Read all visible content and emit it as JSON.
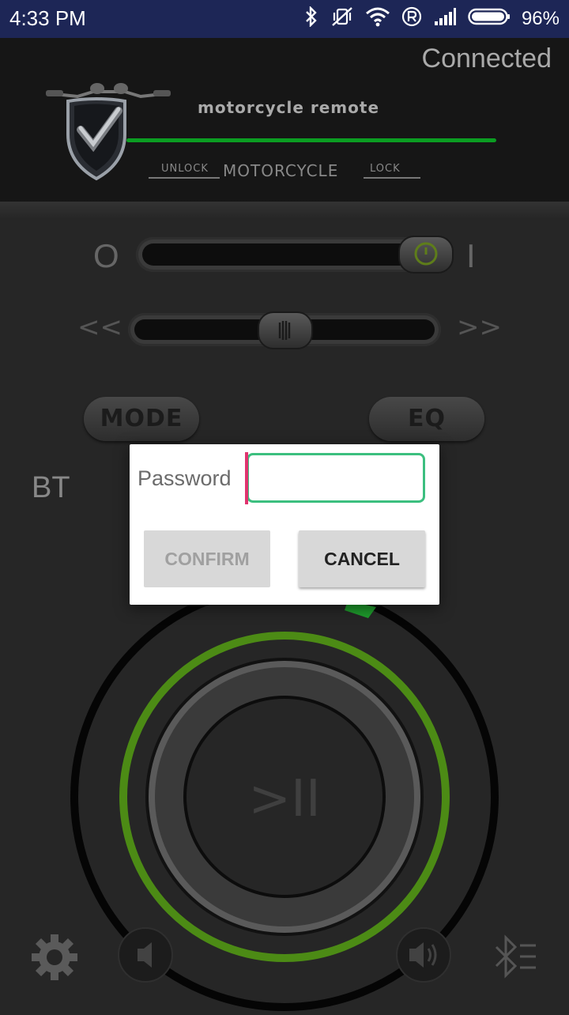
{
  "status": {
    "time": "4:33 PM",
    "battery": "96%"
  },
  "header": {
    "connection": "Connected",
    "brand": "motorcycle  remote",
    "logo_unlock": "UNLOCK",
    "logo_motorcycle": "MOTORCYCLE",
    "logo_lock": "LOCK"
  },
  "controls": {
    "power_off_label": "O",
    "power_on_label": "I",
    "prev_label": "<<",
    "next_label": ">>",
    "mode_label": "MODE",
    "eq_label": "EQ",
    "source_label": "BT",
    "play_pause_label": ">II"
  },
  "dialog": {
    "label": "Password",
    "input_value": "",
    "confirm_label": "CONFIRM",
    "cancel_label": "CANCEL"
  },
  "colors": {
    "status_bar": "#1d2656",
    "accent_green": "#0b9d22",
    "ring_green": "#4c8b15",
    "input_border": "#3cbf7f",
    "caret": "#e0336f"
  }
}
